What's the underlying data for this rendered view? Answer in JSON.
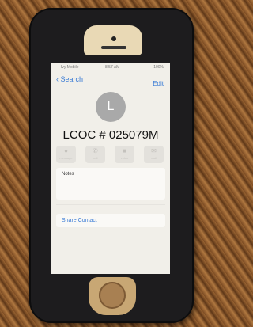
{
  "status": {
    "carrier": "Ivy Mobile",
    "time": "8:57 AM",
    "battery": "100%"
  },
  "nav": {
    "back_label": "Search",
    "edit_label": "Edit"
  },
  "contact": {
    "initial": "L",
    "name": "LCOC # 025079M"
  },
  "actions": [
    {
      "label": "message",
      "icon": "message-icon"
    },
    {
      "label": "call",
      "icon": "phone-icon"
    },
    {
      "label": "video",
      "icon": "video-icon"
    },
    {
      "label": "mail",
      "icon": "mail-icon"
    }
  ],
  "notes": {
    "label": "Notes"
  },
  "share": {
    "label": "Share Contact"
  },
  "colors": {
    "accent": "#3a7bd5",
    "screen_bg": "#f1efe9",
    "case": "#1d1c1e"
  }
}
